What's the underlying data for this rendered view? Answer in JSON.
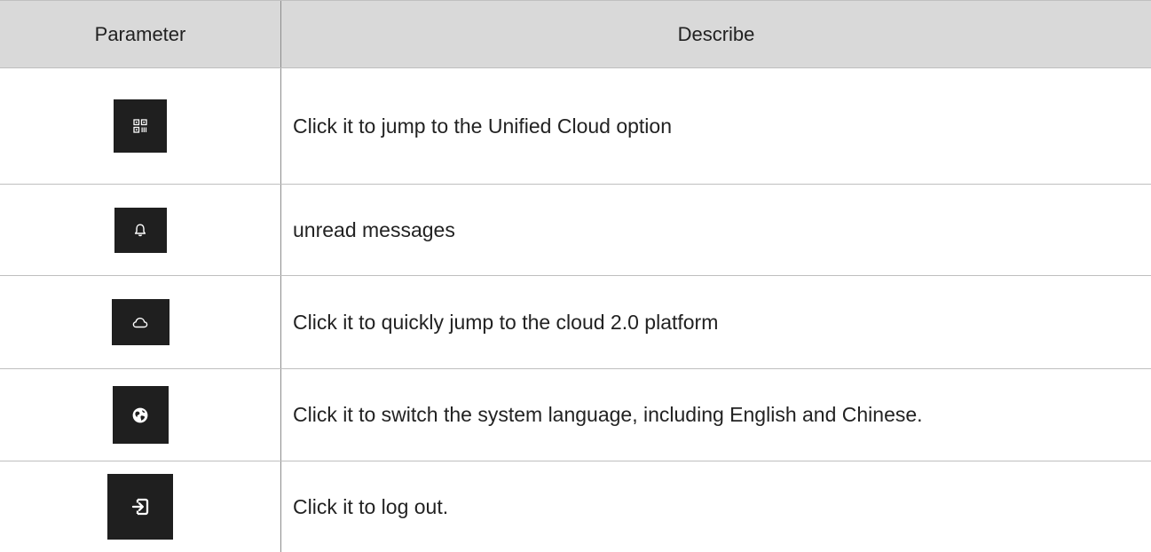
{
  "table": {
    "headers": {
      "parameter": "Parameter",
      "describe": "Describe"
    },
    "rows": [
      {
        "icon": "qr-code-icon",
        "description": "Click it to jump to the Unified Cloud option"
      },
      {
        "icon": "bell-icon",
        "description": "unread messages"
      },
      {
        "icon": "cloud-icon",
        "description": "Click it to quickly jump to the cloud 2.0 platform"
      },
      {
        "icon": "globe-icon",
        "description": "Click it to switch the system language, including English and Chinese."
      },
      {
        "icon": "logout-icon",
        "description": "Click it to log out."
      }
    ]
  },
  "colors": {
    "header_bg": "#d9d9d9",
    "icon_bg": "#1f1f1f",
    "icon_fg": "#ffffff",
    "grid": "#bfbfbf"
  }
}
